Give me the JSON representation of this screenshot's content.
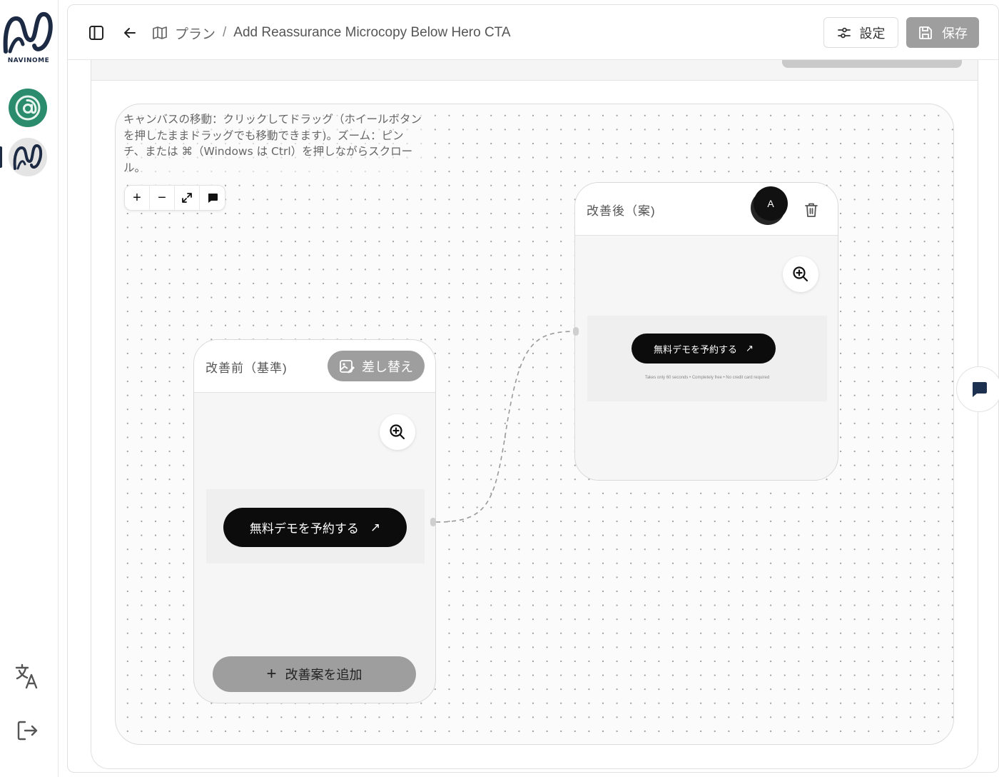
{
  "brand": {
    "name": "NAVINOME"
  },
  "breadcrumb": {
    "section": "プラン",
    "separator": "/",
    "current": "Add Reassurance Microcopy Below Hero CTA"
  },
  "toolbar": {
    "settings_label": "設定",
    "save_label": "保存"
  },
  "canvas": {
    "hint": "キャンバスの移動：クリックしてドラッグ（ホイールボタンを押したままドラッグでも移動できます)。ズーム：ピンチ、または ⌘（Windows は Ctrl）を押しながらスクロール。",
    "zoom_in": "+",
    "zoom_out": "−"
  },
  "before_card": {
    "title": "改善前（基準)",
    "swap_label": "差し替え",
    "cta_label": "無料デモを予約する",
    "cta_arrow": "↗",
    "add_label": "改善案を追加",
    "add_icon": "+"
  },
  "after_card": {
    "title": "改善後（案)",
    "avatar_initial": "A",
    "cta_label": "無料デモを予約する",
    "cta_arrow": "↗",
    "microcopy": "Takes only 60 seconds • Completely free • No credit card required"
  },
  "colors": {
    "brand_navy": "#1d2a44",
    "brand_green": "#2a8c6c",
    "button_gray": "#9e9e9e",
    "cta_black": "#0c0c0c"
  },
  "icons": [
    "sidebar-toggle-icon",
    "back-arrow-icon",
    "map-icon",
    "sliders-icon",
    "save-icon",
    "image-swap-icon",
    "zoom-in-icon",
    "trash-icon",
    "chat-icon",
    "fullscreen-icon",
    "translate-icon",
    "logout-icon"
  ]
}
